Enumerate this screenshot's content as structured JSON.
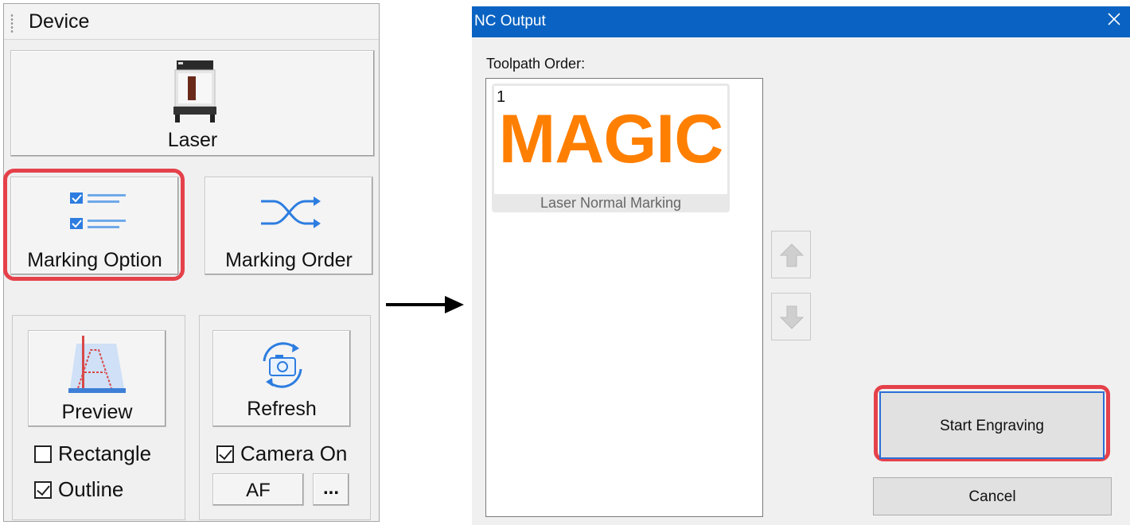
{
  "device_panel": {
    "title": "Device",
    "laser_label": "Laser",
    "marking_option_label": "Marking Option",
    "marking_order_label": "Marking Order",
    "preview_label": "Preview",
    "refresh_label": "Refresh",
    "rectangle_label": "Rectangle",
    "rectangle_checked": false,
    "outline_label": "Outline",
    "outline_checked": true,
    "camera_on_label": "Camera On",
    "camera_on_checked": true,
    "af_label": "AF",
    "more_label": "..."
  },
  "dialog": {
    "title": "NC Output",
    "toolpath_order_label": "Toolpath Order:",
    "items": [
      {
        "index": "1",
        "thumbnail_text": "MAGIC",
        "caption": "Laser Normal Marking"
      }
    ],
    "start_label": "Start Engraving",
    "cancel_label": "Cancel"
  },
  "colors": {
    "titlebar": "#0a63c2",
    "highlight": "#e5414a",
    "thumbnail_text": "#ff7f00"
  },
  "icons": {
    "laser": "laser-machine-icon",
    "marking_option": "checklist-icon",
    "marking_order": "shuffle-icon",
    "preview": "preview-icon",
    "refresh": "refresh-camera-icon",
    "close": "close-icon",
    "up": "arrow-up-icon",
    "down": "arrow-down-icon",
    "flow": "right-arrow-icon"
  }
}
